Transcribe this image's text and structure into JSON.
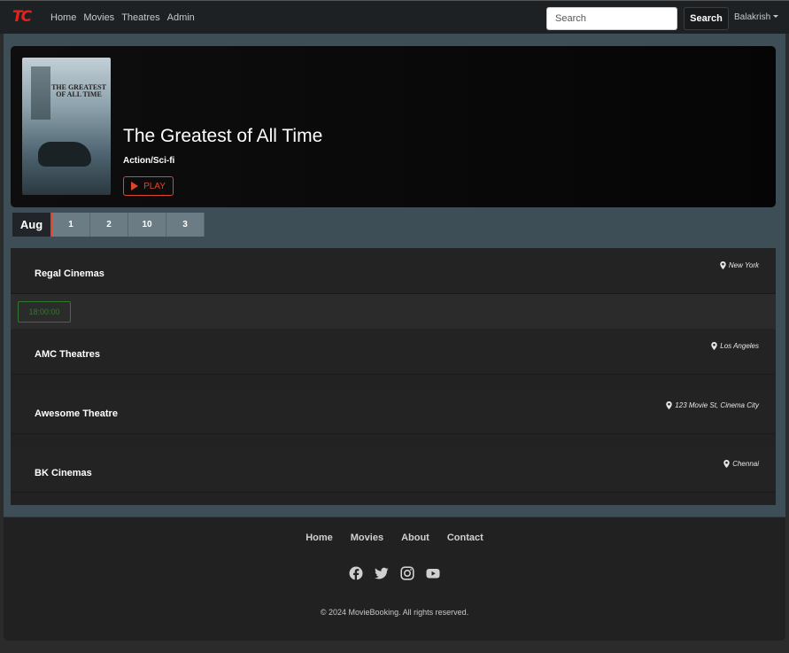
{
  "brand": {
    "logo_text": "TC",
    "accent": "#e8201c"
  },
  "nav": {
    "links": [
      "Home",
      "Movies",
      "Theatres",
      "Admin"
    ],
    "search_placeholder": "Search",
    "search_button": "Search",
    "user": "Balakrish"
  },
  "movie": {
    "title": "The Greatest of All Time",
    "genre": "Action/Sci-fi",
    "play_label": "PLAY",
    "poster_text": "THE GREATEST OF ALL TIME"
  },
  "dates": {
    "month": "Aug",
    "days": [
      "1",
      "2",
      "10",
      "3"
    ]
  },
  "theatres": [
    {
      "name": "Regal Cinemas",
      "location": "New York",
      "showtimes": [
        "18:00:00"
      ]
    },
    {
      "name": "AMC Theatres",
      "location": "Los Angeles",
      "showtimes": []
    },
    {
      "name": "Awesome Theatre",
      "location": "123 Movie St, Cinema City",
      "showtimes": []
    },
    {
      "name": "BK Cinemas",
      "location": "Chennai",
      "showtimes": []
    }
  ],
  "footer": {
    "links": [
      "Home",
      "Movies",
      "About",
      "Contact"
    ],
    "social": [
      "facebook-icon",
      "twitter-icon",
      "instagram-icon",
      "youtube-icon"
    ],
    "copyright": "© 2024 MovieBooking. All rights reserved."
  },
  "colors": {
    "accent_orange": "#e0442b",
    "showtime_green": "#2f7a2f",
    "date_bar": "#3d4e56"
  }
}
